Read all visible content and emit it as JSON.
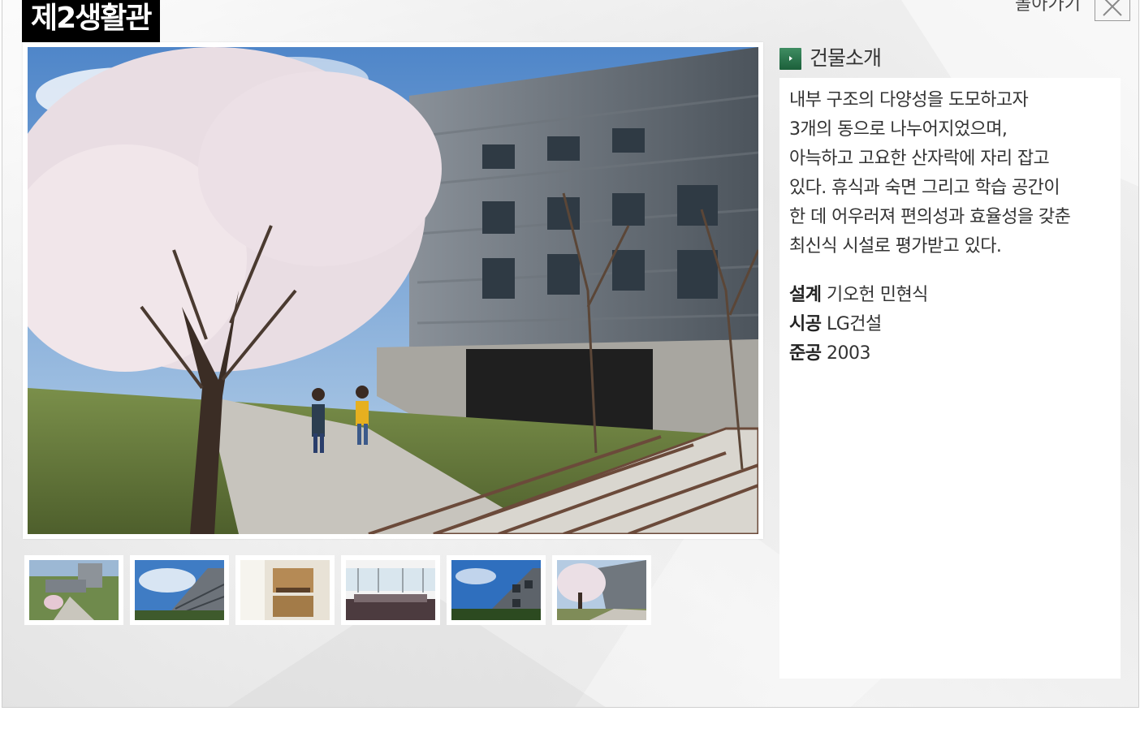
{
  "header": {
    "title": "제2생활관",
    "back_label": "돌아가기"
  },
  "section": {
    "heading": "건물소개"
  },
  "description": [
    "내부 구조의 다양성을 도모하고자",
    "3개의 동으로 나누어지었으며,",
    "아늑하고 고요한 산자락에 자리 잡고",
    "있다. 휴식과 숙면 그리고 학습 공간이",
    "한 데 어우러져 편의성과 효율성을 갖춘",
    "최신식 시설로 평가받고 있다."
  ],
  "meta": {
    "design_label": "설계",
    "design_value": "기오헌 민현식",
    "builder_label": "시공",
    "builder_value": "LG건설",
    "completed_label": "준공",
    "completed_value": "2003"
  },
  "icons": {
    "heading_icon": "chevron-right-icon",
    "close_icon": "close-icon"
  },
  "colors": {
    "title_bg": "#000000",
    "accent_green": "#2e7a4e"
  }
}
